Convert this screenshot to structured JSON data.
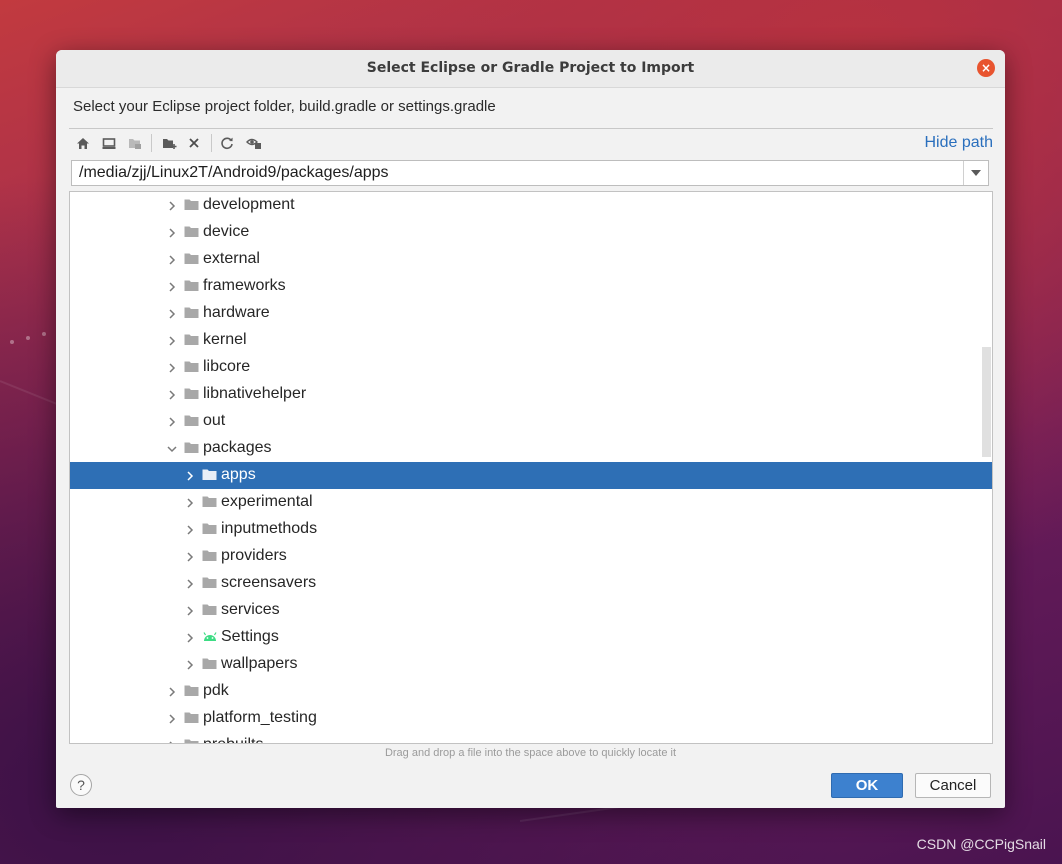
{
  "dialog": {
    "title": "Select Eclipse or Gradle Project to Import",
    "close_glyph": "×",
    "description": "Select your Eclipse project folder, build.gradle or settings.gradle",
    "hide_path_label": "Hide path",
    "path_value": "/media/zjj/Linux2T/Android9/packages/apps",
    "toolbar_icons": [
      "home-icon",
      "desktop-icon",
      "project-folder-icon",
      "new-folder-icon",
      "delete-icon",
      "refresh-icon",
      "show-hidden-icon"
    ],
    "tree": [
      {
        "label": "development",
        "level": 0,
        "expanded": false,
        "icon": "folder-icon"
      },
      {
        "label": "device",
        "level": 0,
        "expanded": false,
        "icon": "folder-icon"
      },
      {
        "label": "external",
        "level": 0,
        "expanded": false,
        "icon": "folder-icon"
      },
      {
        "label": "frameworks",
        "level": 0,
        "expanded": false,
        "icon": "folder-icon"
      },
      {
        "label": "hardware",
        "level": 0,
        "expanded": false,
        "icon": "folder-icon"
      },
      {
        "label": "kernel",
        "level": 0,
        "expanded": false,
        "icon": "folder-icon"
      },
      {
        "label": "libcore",
        "level": 0,
        "expanded": false,
        "icon": "folder-icon"
      },
      {
        "label": "libnativehelper",
        "level": 0,
        "expanded": false,
        "icon": "folder-icon"
      },
      {
        "label": "out",
        "level": 0,
        "expanded": false,
        "icon": "folder-icon"
      },
      {
        "label": "packages",
        "level": 0,
        "expanded": true,
        "icon": "folder-icon"
      },
      {
        "label": "apps",
        "level": 1,
        "expanded": false,
        "icon": "folder-icon",
        "selected": true
      },
      {
        "label": "experimental",
        "level": 1,
        "expanded": false,
        "icon": "folder-icon"
      },
      {
        "label": "inputmethods",
        "level": 1,
        "expanded": false,
        "icon": "folder-icon"
      },
      {
        "label": "providers",
        "level": 1,
        "expanded": false,
        "icon": "folder-icon"
      },
      {
        "label": "screensavers",
        "level": 1,
        "expanded": false,
        "icon": "folder-icon"
      },
      {
        "label": "services",
        "level": 1,
        "expanded": false,
        "icon": "folder-icon"
      },
      {
        "label": "Settings",
        "level": 1,
        "expanded": false,
        "icon": "android-icon"
      },
      {
        "label": "wallpapers",
        "level": 1,
        "expanded": false,
        "icon": "folder-icon"
      },
      {
        "label": "pdk",
        "level": 0,
        "expanded": false,
        "icon": "folder-icon"
      },
      {
        "label": "platform_testing",
        "level": 0,
        "expanded": false,
        "icon": "folder-icon"
      },
      {
        "label": "prebuilts",
        "level": 0,
        "expanded": false,
        "icon": "folder-icon"
      }
    ],
    "drag_hint": "Drag and drop a file into the space above to quickly locate it",
    "help_label": "?",
    "ok_label": "OK",
    "cancel_label": "Cancel",
    "colors": {
      "selection": "#2e6fb5",
      "link": "#2a6fbd",
      "close": "#e8542f",
      "ok": "#3d81cf"
    }
  },
  "watermark": "CSDN @CCPigSnail"
}
